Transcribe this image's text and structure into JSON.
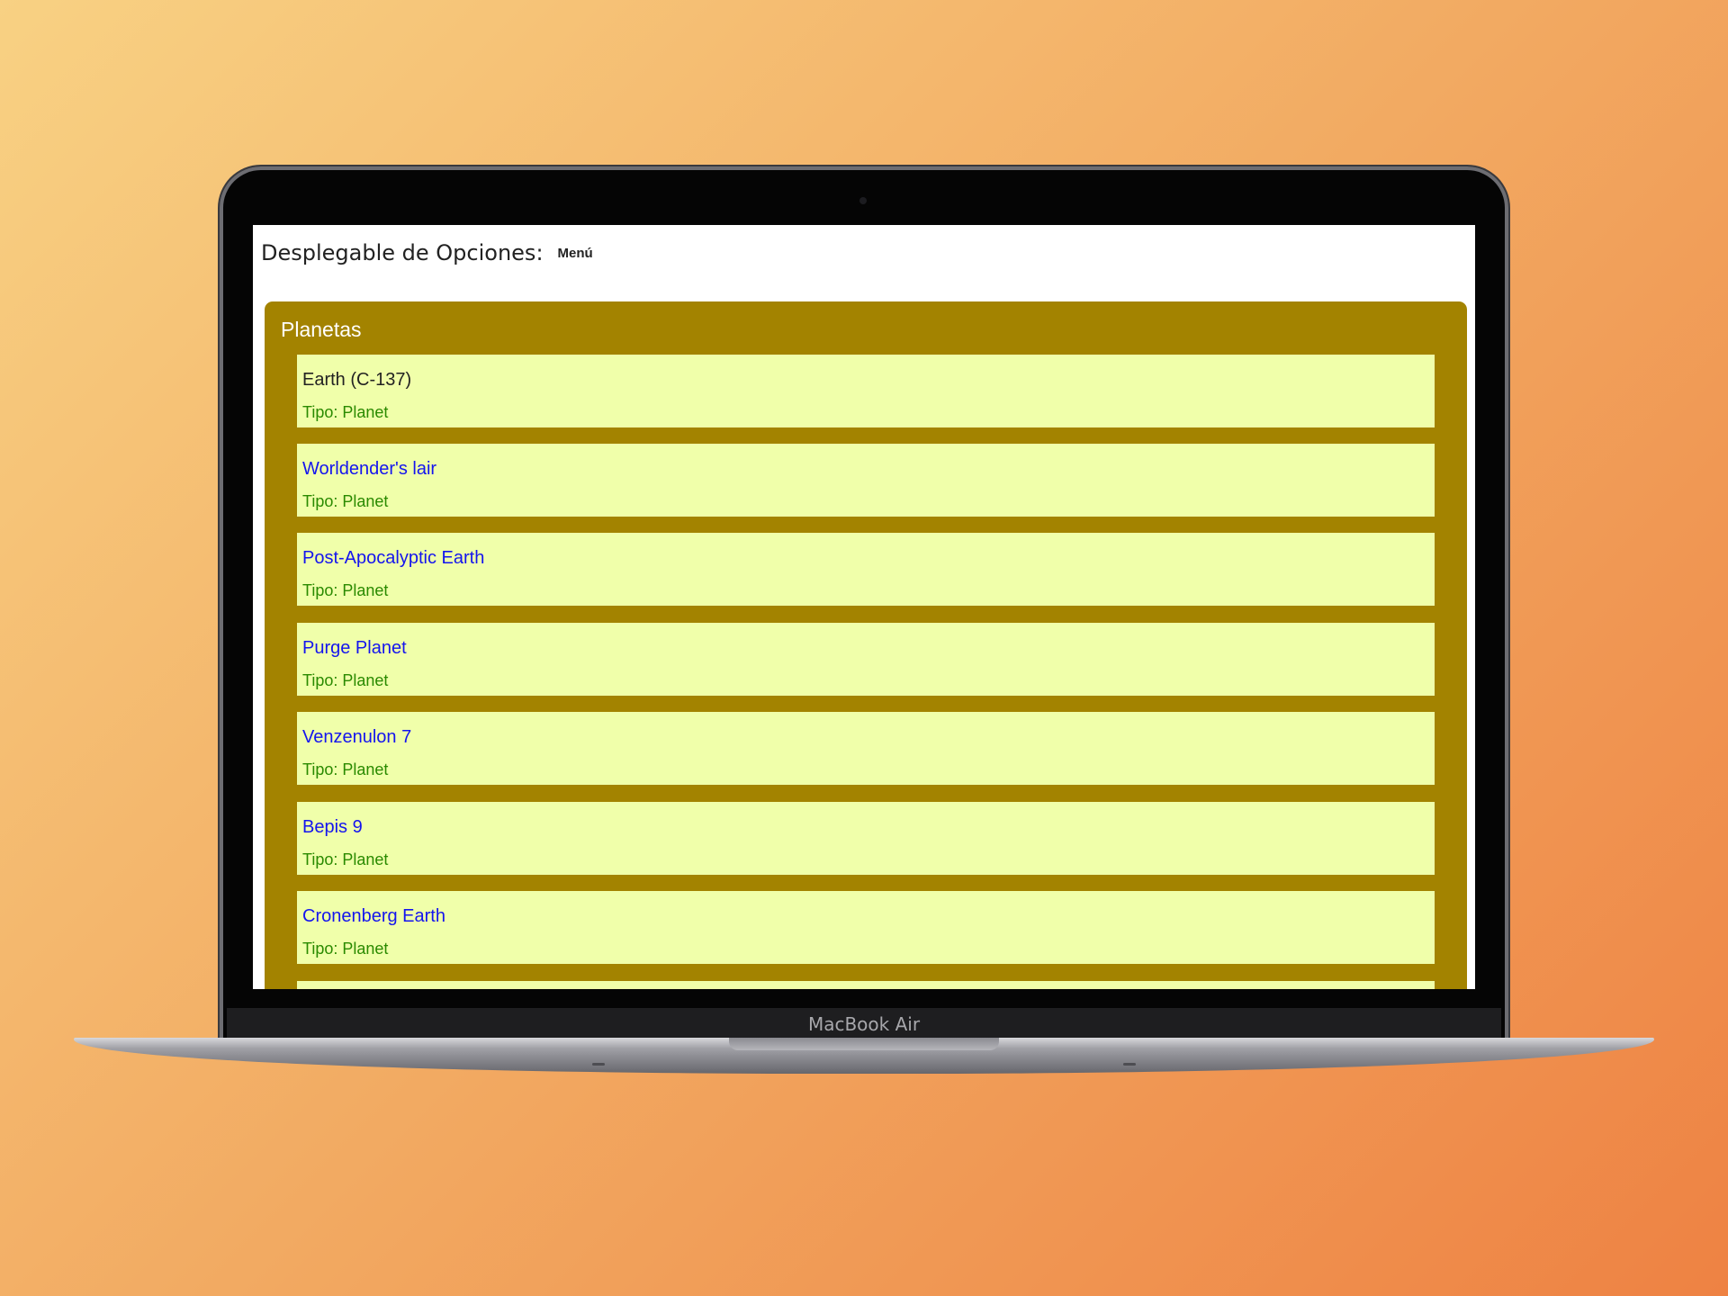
{
  "device": {
    "label": "MacBook Air"
  },
  "header": {
    "title": "Desplegable de Opciones:",
    "menu_label": "Menú"
  },
  "section": {
    "title": "Planetas",
    "items": [
      {
        "name": "Earth (C-137)",
        "type": "Tipo: Planet"
      },
      {
        "name": "Worldender's lair",
        "type": "Tipo: Planet"
      },
      {
        "name": "Post-Apocalyptic Earth",
        "type": "Tipo: Planet"
      },
      {
        "name": "Purge Planet",
        "type": "Tipo: Planet"
      },
      {
        "name": "Venzenulon 7",
        "type": "Tipo: Planet"
      },
      {
        "name": "Bepis 9",
        "type": "Tipo: Planet"
      },
      {
        "name": "Cronenberg Earth",
        "type": "Tipo: Planet"
      }
    ]
  },
  "colors": {
    "panel": "#a38300",
    "item_bg": "#f0ffaa",
    "link": "#1414ee",
    "type_text": "#2a8a00"
  }
}
